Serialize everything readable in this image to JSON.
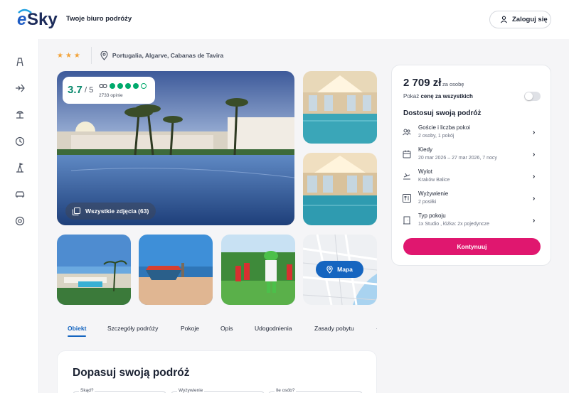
{
  "header": {
    "logo_text": "eSky",
    "tagline": "Twoje biuro podróży",
    "login_label": "Zaloguj się"
  },
  "sidebar": {
    "icons": [
      "hotel-icon",
      "flight-icon",
      "vacation-icon",
      "last-minute-icon",
      "excursion-icon",
      "car-icon",
      "support-icon"
    ]
  },
  "hotel": {
    "stars": "★★★",
    "location": "Portugalia, Algarve, Cabanas de Tavira",
    "rating_value": "3.7",
    "rating_of": "/ 5",
    "tripadvisor_score": 4,
    "tripadvisor_max": 5,
    "reviews_count": "2733 opinie",
    "all_photos_label": "Wszystkie zdjęcia (63)",
    "map_label": "Mapa"
  },
  "tabs": [
    {
      "label": "Obiekt",
      "active": true
    },
    {
      "label": "Szczegóły podróży",
      "active": false
    },
    {
      "label": "Pokoje",
      "active": false
    },
    {
      "label": "Opis",
      "active": false
    },
    {
      "label": "Udogodnienia",
      "active": false
    },
    {
      "label": "Zasady pobytu",
      "active": false
    }
  ],
  "adjust": {
    "title": "Dopasuj swoją podróż",
    "fields": [
      {
        "label": "Skąd?"
      },
      {
        "label": "Wyżywienie"
      },
      {
        "label": "Ile osób?"
      }
    ]
  },
  "booking": {
    "price": "2 709 zł",
    "price_unit": "za osobę",
    "toggle_prefix": "Pokaż ",
    "toggle_bold": "cenę za wszystkich",
    "toggle_on": false,
    "section_title": "Dostosuj swoją podróż",
    "options": [
      {
        "icon": "guests-icon",
        "title": "Goście i liczba pokoi",
        "value": "2 osoby, 1 pokój"
      },
      {
        "icon": "calendar-icon",
        "title": "Kiedy",
        "value": "20 mar 2026 – 27 mar 2026, 7 nocy"
      },
      {
        "icon": "departure-icon",
        "title": "Wylot",
        "value": "Kraków Balice"
      },
      {
        "icon": "meal-icon",
        "title": "Wyżywienie",
        "value": "2 posiłki"
      },
      {
        "icon": "room-icon",
        "title": "Typ pokoju",
        "value": "1x Studio , łóżka: 2x pojedyncze"
      }
    ],
    "continue_label": "Kontynuuj"
  },
  "colors": {
    "brand_blue": "#1565c0",
    "accent_pink": "#e0176f",
    "rating_green": "#0b8a6e",
    "tripadvisor_green": "#00aa6c",
    "star_orange": "#f2a33a"
  }
}
